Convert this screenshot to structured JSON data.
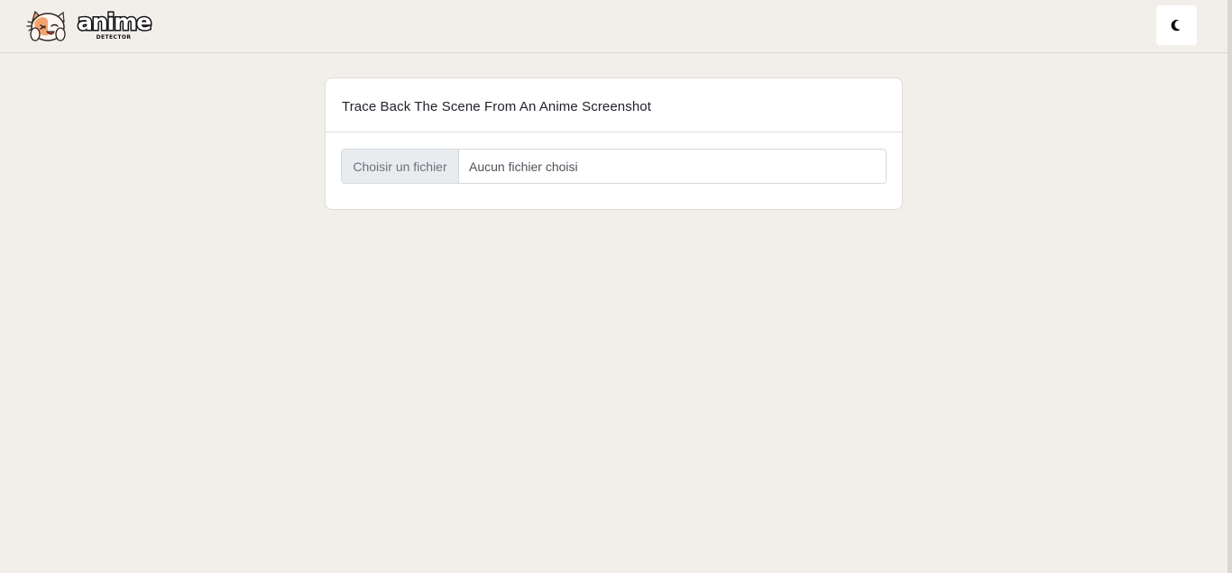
{
  "header": {
    "logo": {
      "main_text": "anime",
      "sub_text": "DETECTOR"
    },
    "theme_toggle_icon": "moon-icon"
  },
  "card": {
    "title": "Trace Back The Scene From An Anime Screenshot",
    "file_input": {
      "button_label": "Choisir un fichier",
      "status_text": "Aucun fichier choisi"
    }
  },
  "colors": {
    "background": "#f2efea",
    "card_background": "#ffffff",
    "file_button_background": "#e9ecef",
    "border": "#d6d9dd"
  }
}
